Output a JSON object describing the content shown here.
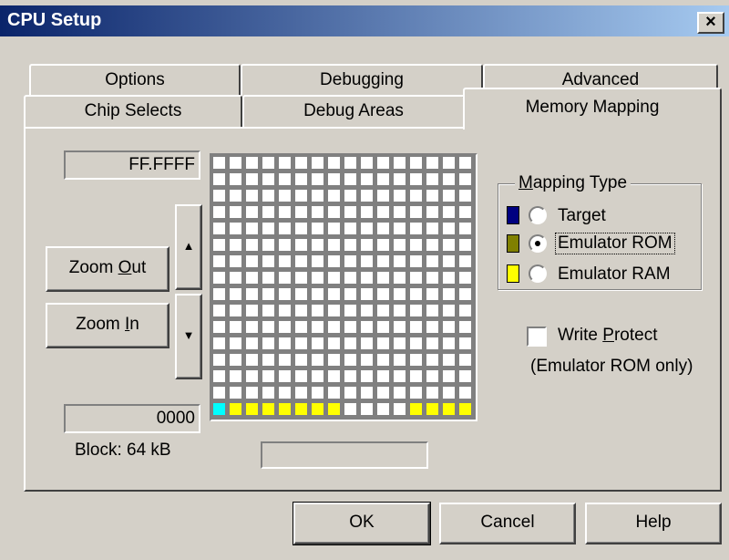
{
  "window": {
    "title": "CPU Setup",
    "close_label": "×"
  },
  "tabs": {
    "row_back": [
      "Options",
      "Debugging",
      "Advanced"
    ],
    "row_front": [
      "Chip Selects",
      "Debug Areas",
      "Memory Mapping"
    ],
    "selected": "Memory Mapping"
  },
  "memory": {
    "top_address": "FF.FFFF",
    "bottom_address": "0000",
    "block_label": "Block: 64 kB",
    "status_field": "",
    "grid_rows": 16,
    "grid_cols": 16,
    "bottom_row_types": [
      "ram_selected",
      "ram",
      "ram",
      "ram",
      "ram",
      "ram",
      "ram",
      "ram",
      "none",
      "none",
      "none",
      "none",
      "ram",
      "ram",
      "ram",
      "ram"
    ]
  },
  "zoom": {
    "zoom_out_prefix": "Zoom ",
    "zoom_out_key": "O",
    "zoom_out_suffix": "ut",
    "zoom_in_prefix": "Zoom ",
    "zoom_in_key": "I",
    "zoom_in_suffix": "n",
    "scroll_up": "▲",
    "scroll_down": "▼"
  },
  "mapping_type": {
    "label_key": "M",
    "label_rest": "apping Type",
    "options": [
      {
        "label": "Target",
        "color": "#000080",
        "selected": false
      },
      {
        "label": "Emulator ROM",
        "color": "#808000",
        "selected": true
      },
      {
        "label": "Emulator RAM",
        "color": "#ffff00",
        "selected": false
      }
    ]
  },
  "write_protect": {
    "label_prefix": "Write ",
    "label_key": "P",
    "label_suffix": "rotect",
    "note": "(Emulator ROM only)",
    "checked": false
  },
  "buttons": {
    "ok": "OK",
    "cancel": "Cancel",
    "help": "Help"
  },
  "colors": {
    "ram": "#ffff00",
    "ram_selected": "#00ffff",
    "free": "#ffffff"
  }
}
